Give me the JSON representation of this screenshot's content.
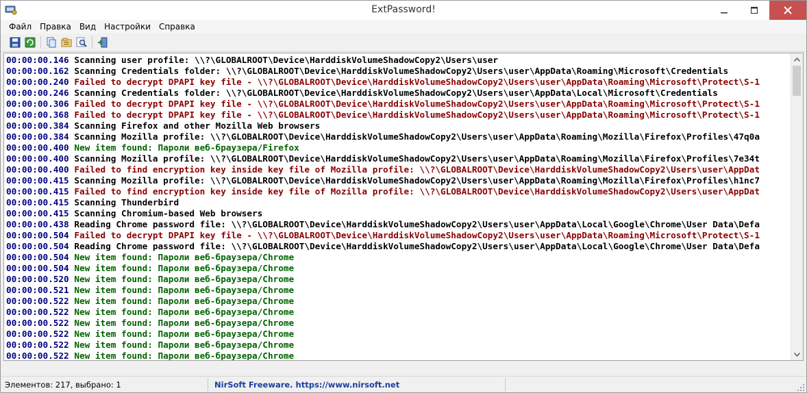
{
  "window": {
    "title": "ExtPassword!",
    "icon": "extpassword-app-icon"
  },
  "menu": {
    "items": [
      {
        "label": "Файл"
      },
      {
        "label": "Правка"
      },
      {
        "label": "Вид"
      },
      {
        "label": "Настройки"
      },
      {
        "label": "Справка"
      }
    ]
  },
  "toolbar": {
    "buttons": [
      {
        "icon": "save-icon"
      },
      {
        "icon": "refresh-icon"
      },
      {
        "icon": "copy-icon"
      },
      {
        "icon": "properties-icon"
      },
      {
        "icon": "find-icon"
      },
      {
        "icon": "exit-icon"
      }
    ]
  },
  "log": {
    "colors": {
      "timestamp": "#000080",
      "info": "#000000",
      "error": "#8b0000",
      "success": "#006400"
    },
    "rows": [
      {
        "time": "00:00:00.146",
        "type": "info",
        "text": "Scanning user profile: \\\\?\\GLOBALROOT\\Device\\HarddiskVolumeShadowCopy2\\Users\\user"
      },
      {
        "time": "00:00:00.162",
        "type": "info",
        "text": "Scanning Credentials folder: \\\\?\\GLOBALROOT\\Device\\HarddiskVolumeShadowCopy2\\Users\\user\\AppData\\Roaming\\Microsoft\\Credentials"
      },
      {
        "time": "00:00:00.240",
        "type": "error",
        "text": "Failed to decrypt DPAPI key file - \\\\?\\GLOBALROOT\\Device\\HarddiskVolumeShadowCopy2\\Users\\user\\AppData\\Roaming\\Microsoft\\Protect\\S-1"
      },
      {
        "time": "00:00:00.246",
        "type": "info",
        "text": "Scanning Credentials folder: \\\\?\\GLOBALROOT\\Device\\HarddiskVolumeShadowCopy2\\Users\\user\\AppData\\Local\\Microsoft\\Credentials"
      },
      {
        "time": "00:00:00.306",
        "type": "error",
        "text": "Failed to decrypt DPAPI key file - \\\\?\\GLOBALROOT\\Device\\HarddiskVolumeShadowCopy2\\Users\\user\\AppData\\Roaming\\Microsoft\\Protect\\S-1"
      },
      {
        "time": "00:00:00.368",
        "type": "error",
        "text": "Failed to decrypt DPAPI key file - \\\\?\\GLOBALROOT\\Device\\HarddiskVolumeShadowCopy2\\Users\\user\\AppData\\Roaming\\Microsoft\\Protect\\S-1"
      },
      {
        "time": "00:00:00.384",
        "type": "info",
        "text": "Scanning Firefox and other Mozilla Web browsers"
      },
      {
        "time": "00:00:00.384",
        "type": "info",
        "text": "Scanning Mozilla profile: \\\\?\\GLOBALROOT\\Device\\HarddiskVolumeShadowCopy2\\Users\\user\\AppData\\Roaming\\Mozilla\\Firefox\\Profiles\\47q0a"
      },
      {
        "time": "00:00:00.400",
        "type": "success",
        "text": "New item found: Пароли веб-браузера/Firefox"
      },
      {
        "time": "00:00:00.400",
        "type": "info",
        "text": "Scanning Mozilla profile: \\\\?\\GLOBALROOT\\Device\\HarddiskVolumeShadowCopy2\\Users\\user\\AppData\\Roaming\\Mozilla\\Firefox\\Profiles\\7e34t"
      },
      {
        "time": "00:00:00.400",
        "type": "error",
        "text": "Failed to find encryption key inside key file of Mozilla profile: \\\\?\\GLOBALROOT\\Device\\HarddiskVolumeShadowCopy2\\Users\\user\\AppDat"
      },
      {
        "time": "00:00:00.415",
        "type": "info",
        "text": "Scanning Mozilla profile: \\\\?\\GLOBALROOT\\Device\\HarddiskVolumeShadowCopy2\\Users\\user\\AppData\\Roaming\\Mozilla\\Firefox\\Profiles\\h1nc7"
      },
      {
        "time": "00:00:00.415",
        "type": "error",
        "text": "Failed to find encryption key inside key file of Mozilla profile: \\\\?\\GLOBALROOT\\Device\\HarddiskVolumeShadowCopy2\\Users\\user\\AppDat"
      },
      {
        "time": "00:00:00.415",
        "type": "info",
        "text": "Scanning Thunderbird"
      },
      {
        "time": "00:00:00.415",
        "type": "info",
        "text": "Scanning Chromium-based Web browsers"
      },
      {
        "time": "00:00:00.438",
        "type": "info",
        "text": "Reading Chrome password file: \\\\?\\GLOBALROOT\\Device\\HarddiskVolumeShadowCopy2\\Users\\user\\AppData\\Local\\Google\\Chrome\\User Data\\Defa"
      },
      {
        "time": "00:00:00.504",
        "type": "error",
        "text": "Failed to decrypt DPAPI key file - \\\\?\\GLOBALROOT\\Device\\HarddiskVolumeShadowCopy2\\Users\\user\\AppData\\Roaming\\Microsoft\\Protect\\S-1"
      },
      {
        "time": "00:00:00.504",
        "type": "info",
        "text": "Reading Chrome password file: \\\\?\\GLOBALROOT\\Device\\HarddiskVolumeShadowCopy2\\Users\\user\\AppData\\Local\\Google\\Chrome\\User Data\\Defa"
      },
      {
        "time": "00:00:00.504",
        "type": "success",
        "text": "New item found: Пароли веб-браузера/Chrome"
      },
      {
        "time": "00:00:00.504",
        "type": "success",
        "text": "New item found: Пароли веб-браузера/Chrome"
      },
      {
        "time": "00:00:00.520",
        "type": "success",
        "text": "New item found: Пароли веб-браузера/Chrome"
      },
      {
        "time": "00:00:00.521",
        "type": "success",
        "text": "New item found: Пароли веб-браузера/Chrome"
      },
      {
        "time": "00:00:00.522",
        "type": "success",
        "text": "New item found: Пароли веб-браузера/Chrome"
      },
      {
        "time": "00:00:00.522",
        "type": "success",
        "text": "New item found: Пароли веб-браузера/Chrome"
      },
      {
        "time": "00:00:00.522",
        "type": "success",
        "text": "New item found: Пароли веб-браузера/Chrome"
      },
      {
        "time": "00:00:00.522",
        "type": "success",
        "text": "New item found: Пароли веб-браузера/Chrome"
      },
      {
        "time": "00:00:00.522",
        "type": "success",
        "text": "New item found: Пароли веб-браузера/Chrome"
      },
      {
        "time": "00:00:00.522",
        "type": "success",
        "text": "New item found: Пароли веб-браузера/Chrome"
      }
    ]
  },
  "status": {
    "items_text": "Элементов: 217, выбрано: 1",
    "link_text": "NirSoft Freeware. https://www.nirsoft.net"
  }
}
